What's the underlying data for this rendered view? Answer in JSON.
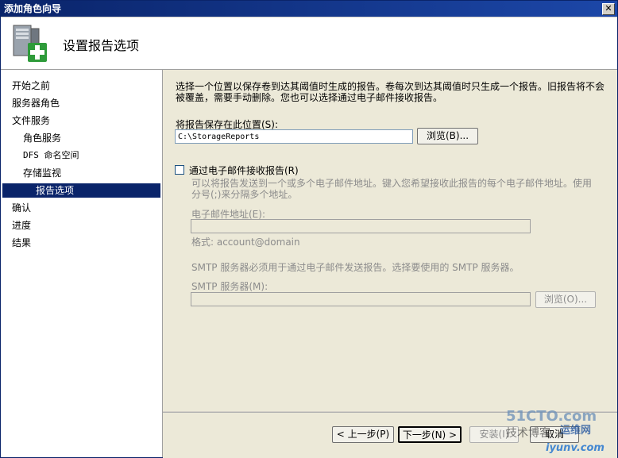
{
  "window": {
    "title": "添加角色向导",
    "close_glyph": "✕"
  },
  "header": {
    "title": "设置报告选项"
  },
  "nav": {
    "items": [
      {
        "label": "开始之前"
      },
      {
        "label": "服务器角色"
      },
      {
        "label": "文件服务"
      },
      {
        "label": "角色服务"
      },
      {
        "label": "DFS 命名空间"
      },
      {
        "label": "存储监视"
      },
      {
        "label": "报告选项"
      },
      {
        "label": "确认"
      },
      {
        "label": "进度"
      },
      {
        "label": "结果"
      }
    ],
    "selected": "报告选项"
  },
  "main": {
    "description": "选择一个位置以保存卷到达其阈值时生成的报告。卷每次到达其阈值时只生成一个报告。旧报告将不会被覆盖，需要手动删除。您也可以选择通过电子邮件接收报告。",
    "save_location": {
      "label": "将报告保存在此位置(S):",
      "value": "C:\\StorageReports",
      "browse_label": "浏览(B)..."
    },
    "email": {
      "checkbox_label": "通过电子邮件接收报告(R)",
      "checked": false,
      "description": "可以将报告发送到一个或多个电子邮件地址。键入您希望接收此报告的每个电子邮件地址。使用分号(;)来分隔多个地址。",
      "address_label": "电子邮件地址(E):",
      "address_value": "",
      "format_hint": "格式: account@domain",
      "smtp_note": "SMTP 服务器必须用于通过电子邮件发送报告。选择要使用的 SMTP 服务器。",
      "smtp_label": "SMTP 服务器(M):",
      "smtp_value": "",
      "smtp_browse_label": "浏览(O)..."
    }
  },
  "footer": {
    "back_label": "< 上一步(P)",
    "next_label": "下一步(N) >",
    "install_label": "安装(I)",
    "cancel_label": "取消"
  },
  "watermark": {
    "line1": "51CTO.com",
    "line2": "技术博客",
    "line3": "运维网",
    "line4": "iyunv.com"
  }
}
